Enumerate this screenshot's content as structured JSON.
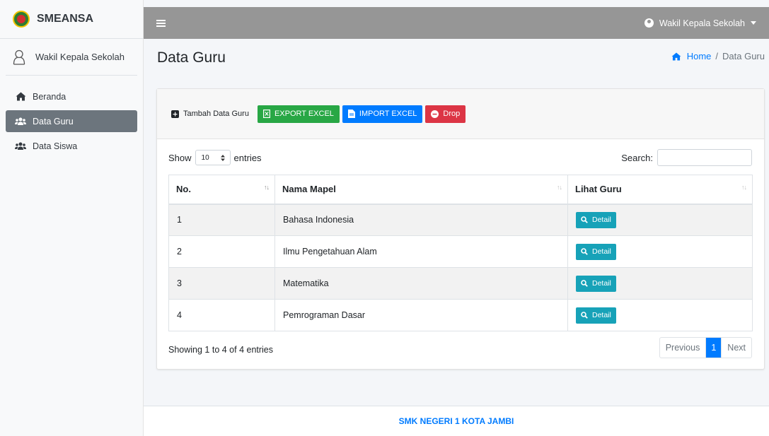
{
  "brand": {
    "name": "SMEANSA"
  },
  "user_panel": {
    "name": "Wakil Kepala Sekolah"
  },
  "sidebar": {
    "items": [
      {
        "label": "Beranda",
        "icon": "home-icon"
      },
      {
        "label": "Data Guru",
        "icon": "users-icon",
        "active": true
      },
      {
        "label": "Data Siswa",
        "icon": "users-icon"
      }
    ]
  },
  "topbar": {
    "user_label": "Wakil Kepala Sekolah"
  },
  "page": {
    "title": "Data Guru"
  },
  "breadcrumb": {
    "home": "Home",
    "separator": "/",
    "current": "Data Guru"
  },
  "toolbar": {
    "add_label": "Tambah Data Guru",
    "export_label": "EXPORT EXCEL",
    "import_label": "IMPORT EXCEL",
    "drop_label": "Drop"
  },
  "datatable": {
    "show_label": "Show",
    "length_value": "10",
    "entries_label": "entries",
    "search_label": "Search:",
    "search_value": "",
    "columns": [
      "No.",
      "Nama Mapel",
      "Lihat Guru"
    ],
    "rows": [
      {
        "no": "1",
        "mapel": "Bahasa Indonesia",
        "action": "Detail"
      },
      {
        "no": "2",
        "mapel": "Ilmu Pengetahuan Alam",
        "action": "Detail"
      },
      {
        "no": "3",
        "mapel": "Matematika",
        "action": "Detail"
      },
      {
        "no": "4",
        "mapel": "Pemrograman Dasar",
        "action": "Detail"
      }
    ],
    "info": "Showing 1 to 4 of 4 entries",
    "pagination": {
      "previous": "Previous",
      "current": "1",
      "next": "Next"
    }
  },
  "footer": {
    "text": "SMK NEGERI 1 KOTA JAMBI"
  },
  "colors": {
    "topbar": "#969696",
    "active_nav": "#6c757d",
    "export": "#28a745",
    "import": "#007bff",
    "drop": "#dc3545",
    "detail": "#17a2b8",
    "link": "#007bff"
  }
}
